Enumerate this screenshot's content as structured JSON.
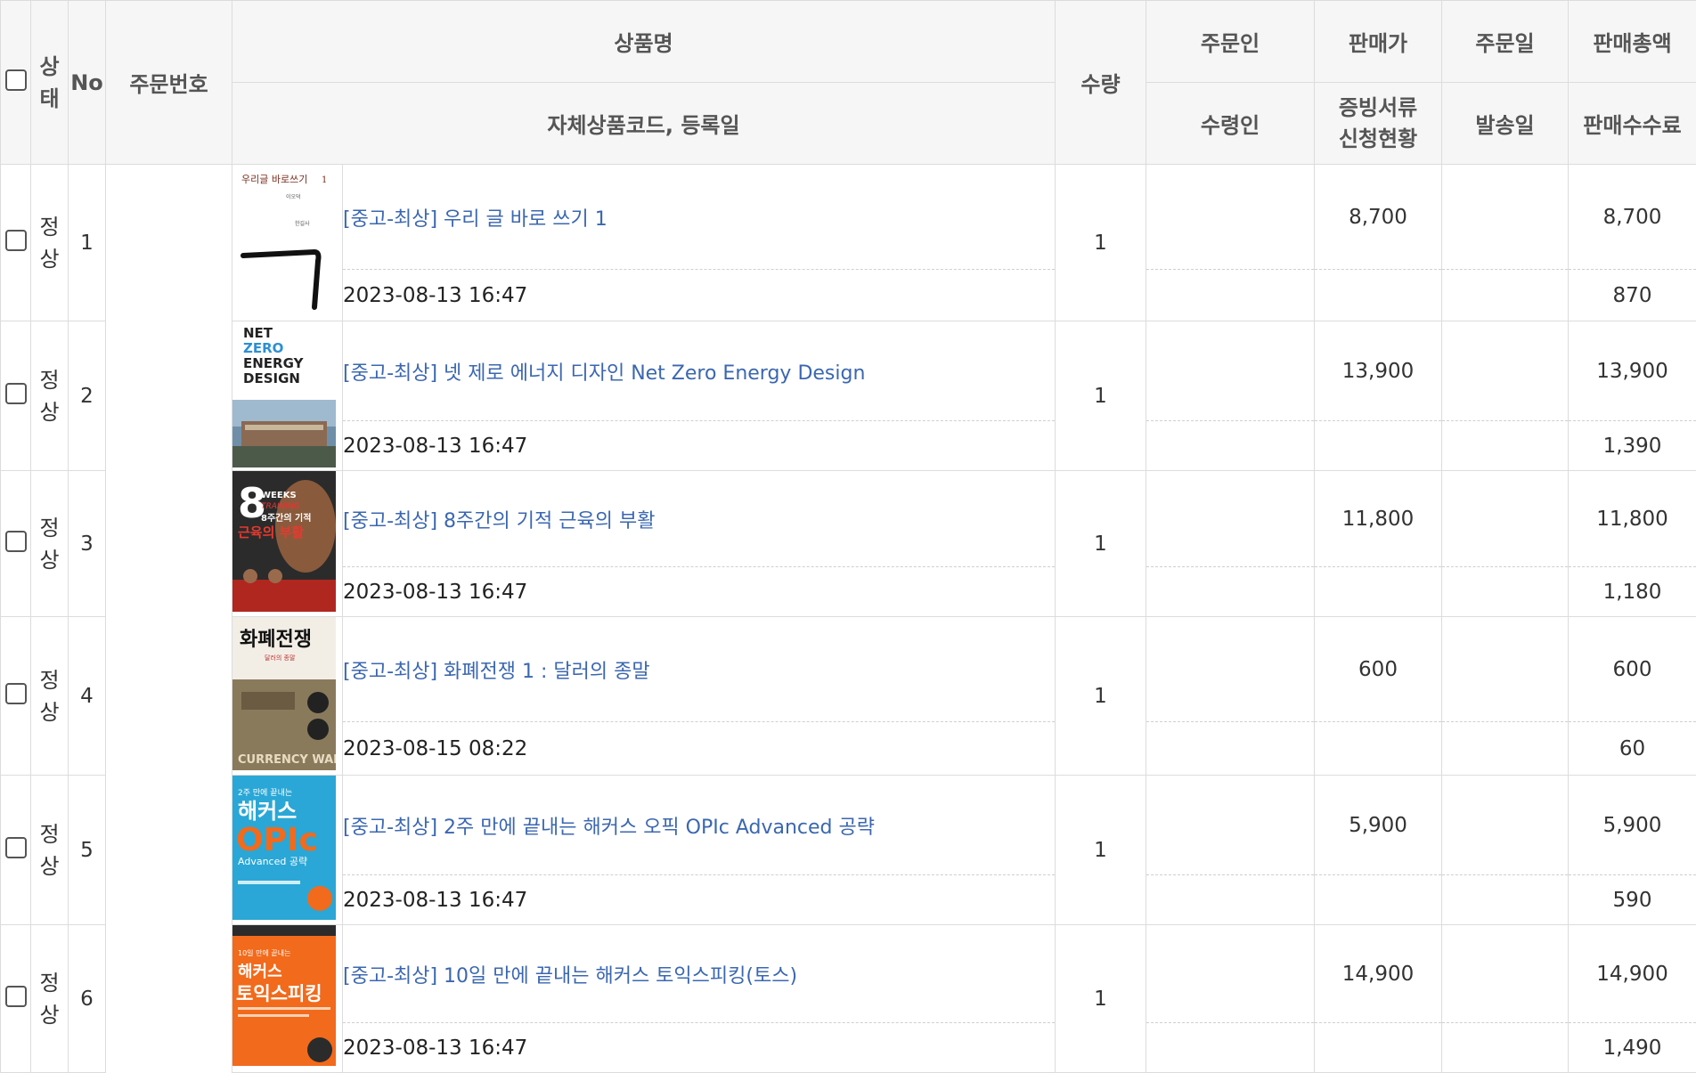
{
  "headers": {
    "status": "상태",
    "no": "No",
    "order_no": "주문번호",
    "product_name": "상품명",
    "product_code_date": "자체상품코드, 등록일",
    "quantity": "수량",
    "orderer": "주문인",
    "receiver": "수령인",
    "price": "판매가",
    "evidence_line1": "증빙서류",
    "evidence_line2": "신청현황",
    "order_date": "주문일",
    "ship_date": "발송일",
    "total": "판매총액",
    "fee": "판매수수료"
  },
  "rows": [
    {
      "status_1": "정",
      "status_2": "상",
      "no": "1",
      "title": "[중고-최상] 우리 글 바로 쓰기 1",
      "date": "2023-08-13 16:47",
      "qty": "1",
      "price": "8,700",
      "total": "8,700",
      "fee": "870",
      "cover": "cover-urigeul",
      "cover_text": "우리글 바로쓰기 1",
      "cover_glyph": "ㄱ"
    },
    {
      "status_1": "정",
      "status_2": "상",
      "no": "2",
      "title": "[중고-최상] 넷 제로 에너지 디자인 Net Zero Energy Design",
      "date": "2023-08-13 16:47",
      "qty": "1",
      "price": "13,900",
      "total": "13,900",
      "fee": "1,390",
      "cover": "cover-netzero",
      "cover_text": [
        "NET",
        "ZERO",
        "ENERGY",
        "DESIGN"
      ]
    },
    {
      "status_1": "정",
      "status_2": "상",
      "no": "3",
      "title": "[중고-최상] 8주간의 기적 근육의 부활",
      "date": "2023-08-13 16:47",
      "qty": "1",
      "price": "11,800",
      "total": "11,800",
      "fee": "1,180",
      "cover": "cover-8weeks",
      "cover_text": [
        "8",
        "WEEKS",
        "TRAINING",
        "8주간의 기적",
        "근육의 부활"
      ]
    },
    {
      "status_1": "정",
      "status_2": "상",
      "no": "4",
      "title": "[중고-최상] 화폐전쟁 1 : 달러의 종말",
      "date": "2023-08-15 08:22",
      "qty": "1",
      "price": "600",
      "total": "600",
      "fee": "60",
      "cover": "cover-currency",
      "cover_text": [
        "화폐전쟁",
        "CURRENCY WARS"
      ]
    },
    {
      "status_1": "정",
      "status_2": "상",
      "no": "5",
      "title": "[중고-최상] 2주 만에 끝내는 해커스 오픽 OPIc Advanced 공략",
      "date": "2023-08-13 16:47",
      "qty": "1",
      "price": "5,900",
      "total": "5,900",
      "fee": "590",
      "cover": "cover-opic",
      "cover_text": [
        "해커스",
        "OPIc",
        "Advanced 공략"
      ]
    },
    {
      "status_1": "정",
      "status_2": "상",
      "no": "6",
      "title": "[중고-최상] 10일 만에 끝내는 해커스 토익스피킹(토스)",
      "date": "2023-08-13 16:47",
      "qty": "1",
      "price": "14,900",
      "total": "14,900",
      "fee": "1,490",
      "cover": "cover-toeic",
      "cover_text": [
        "해커스",
        "토익스피킹"
      ]
    }
  ],
  "colors": {
    "link": "#3b67b0",
    "border": "#dcdcdc",
    "header_bg": "#f6f6f6",
    "opic_blue": "#2aa7d6",
    "toeic_orange": "#f26a1b"
  }
}
